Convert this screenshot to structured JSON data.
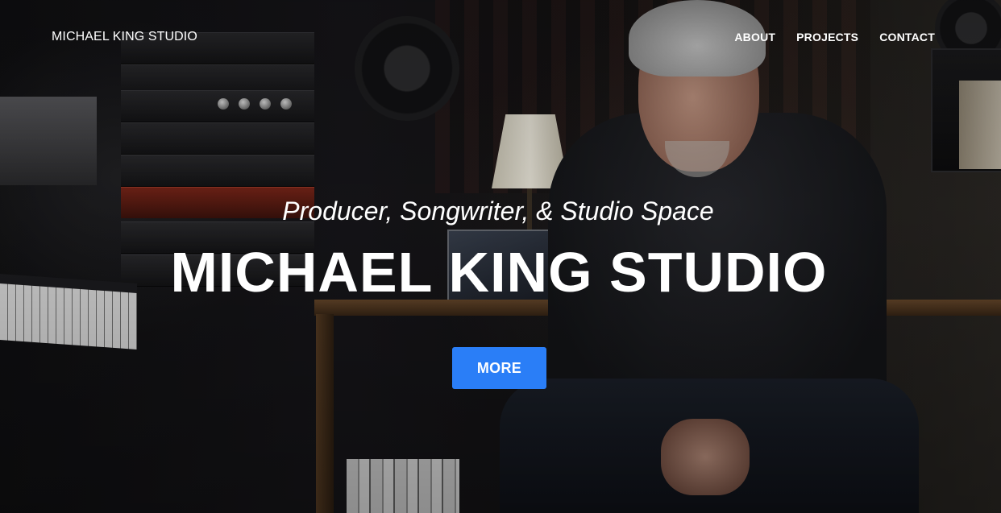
{
  "nav": {
    "brand": "MICHAEL KING STUDIO",
    "links": [
      {
        "label": "ABOUT"
      },
      {
        "label": "PROJECTS"
      },
      {
        "label": "CONTACT"
      }
    ]
  },
  "hero": {
    "subtitle": "Producer, Songwriter, & Studio Space",
    "title": "MICHAEL KING STUDIO",
    "cta_label": "MORE"
  },
  "colors": {
    "accent": "#2a7ef7",
    "text": "#ffffff",
    "background": "#111113"
  }
}
